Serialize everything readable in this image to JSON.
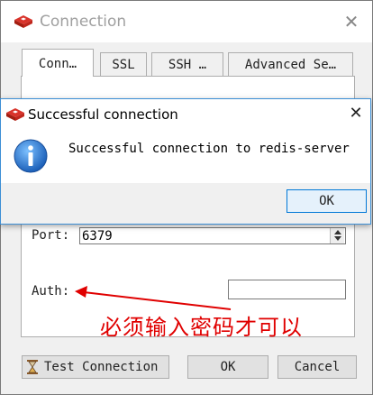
{
  "window": {
    "title": "Connection",
    "close_glyph": "✕",
    "icon": "redis-icon"
  },
  "tabs": [
    {
      "label": "Conn…",
      "active": true
    },
    {
      "label": "SSL",
      "active": false
    },
    {
      "label": "SSH …",
      "active": false
    },
    {
      "label": "Advanced Se…",
      "active": false
    }
  ],
  "form": {
    "port_label": "Port:",
    "port_value": "6379",
    "auth_label": "Auth:",
    "auth_value": ""
  },
  "annotation": {
    "text": "必须输入密码才可以",
    "color": "#e00000"
  },
  "buttons": {
    "test_connection": "Test Connection",
    "ok": "OK",
    "cancel": "Cancel"
  },
  "dialog": {
    "title": "Successful connection",
    "message": "Successful connection to redis-server",
    "ok": "OK",
    "close_glyph": "✕",
    "icon": "info-icon"
  }
}
